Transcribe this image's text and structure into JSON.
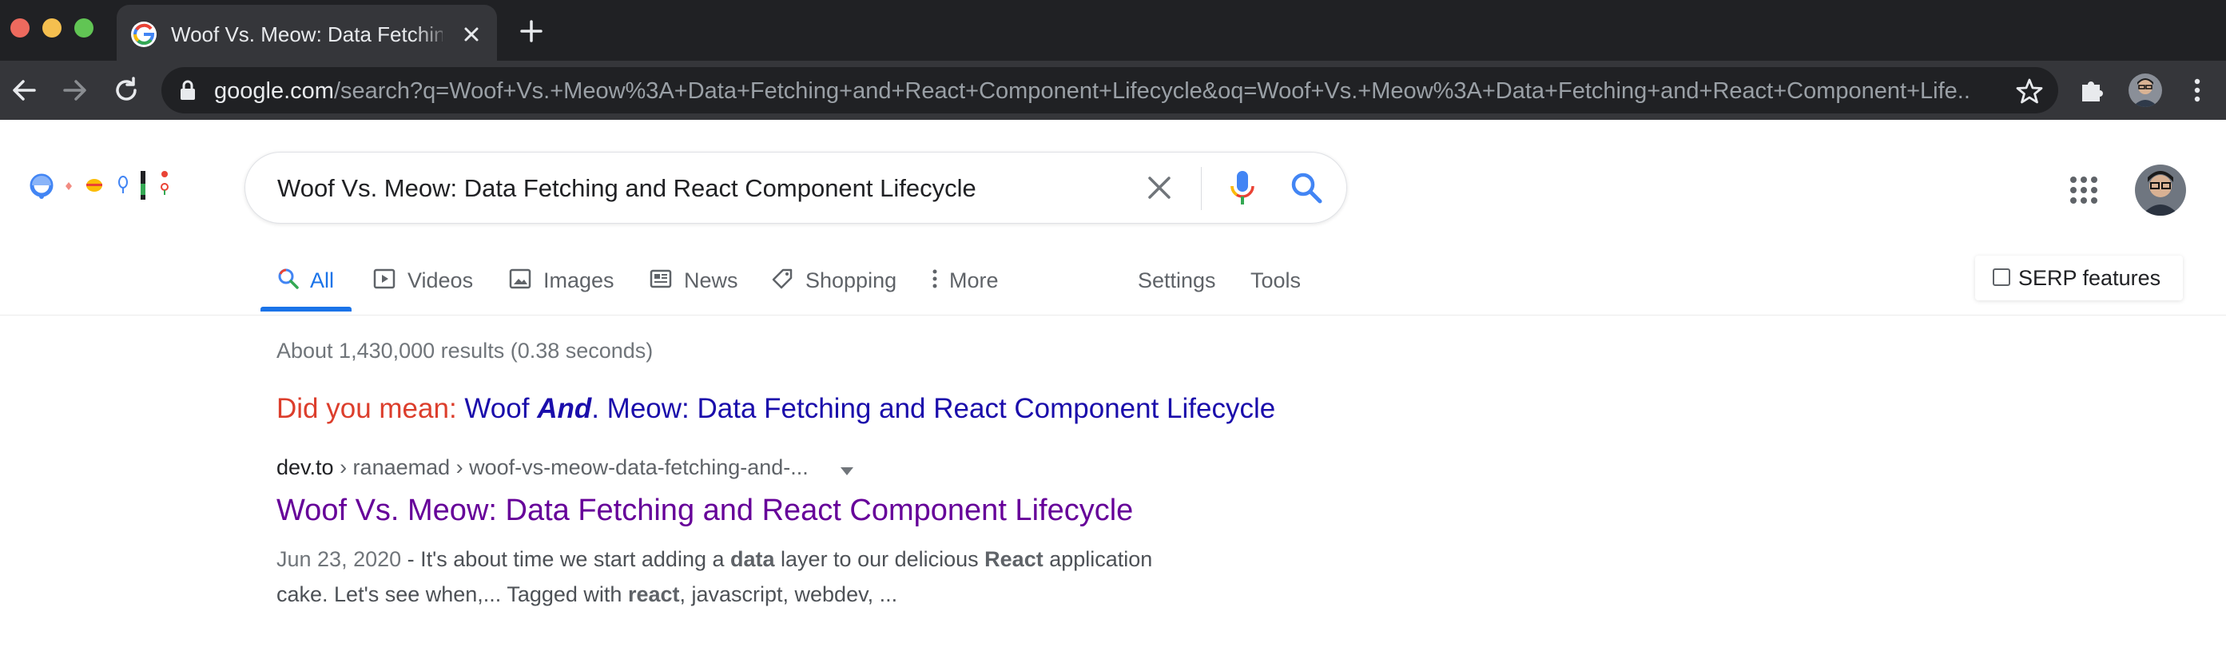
{
  "browser": {
    "tab_title": "Woof Vs. Meow: Data Fetching and React Component Lifecycle - Google Search",
    "url_host": "google.com",
    "url_path": "/search?q=Woof+Vs.+Meow%3A+Data+Fetching+and+React+Component+Lifecycle&oq=Woof+Vs.+Meow%3A+Data+Fetching+and+React+Component+Life..."
  },
  "search": {
    "query": "Woof Vs. Meow: Data Fetching and React Component Lifecycle"
  },
  "tabs": [
    {
      "label": "All",
      "icon": "search-icon"
    },
    {
      "label": "Videos",
      "icon": "video-icon"
    },
    {
      "label": "Images",
      "icon": "image-icon"
    },
    {
      "label": "News",
      "icon": "news-icon"
    },
    {
      "label": "Shopping",
      "icon": "tag-icon"
    },
    {
      "label": "More",
      "icon": "more-vertical-icon"
    },
    {
      "label": "Settings"
    },
    {
      "label": "Tools"
    }
  ],
  "serp_features_label": "SERP features",
  "stats": "About 1,430,000 results (0.38 seconds)",
  "did_you_mean": {
    "label": "Did you mean:",
    "pre": "Woof ",
    "bold": "And",
    "post": ". Meow: Data Fetching and React Component Lifecycle"
  },
  "result": {
    "domain": "dev.to",
    "path": " › ranaemad › woof-vs-meow-data-fetching-and-...",
    "title": "Woof Vs. Meow: Data Fetching and React Component Lifecycle",
    "date": "Jun 23, 2020",
    "snippet": [
      {
        "t": " - It's about time we start adding a "
      },
      {
        "b": "data"
      },
      {
        "t": " layer to our delicious "
      },
      {
        "b": "React"
      },
      {
        "t": " application cake. Let's see when,... Tagged with "
      },
      {
        "b": "react"
      },
      {
        "t": ", javascript, webdev, ..."
      }
    ]
  },
  "colors": {
    "link": "#1a0dab",
    "visited": "#660099",
    "accent": "#1a73e8",
    "dym_red": "#dc3e2c"
  }
}
